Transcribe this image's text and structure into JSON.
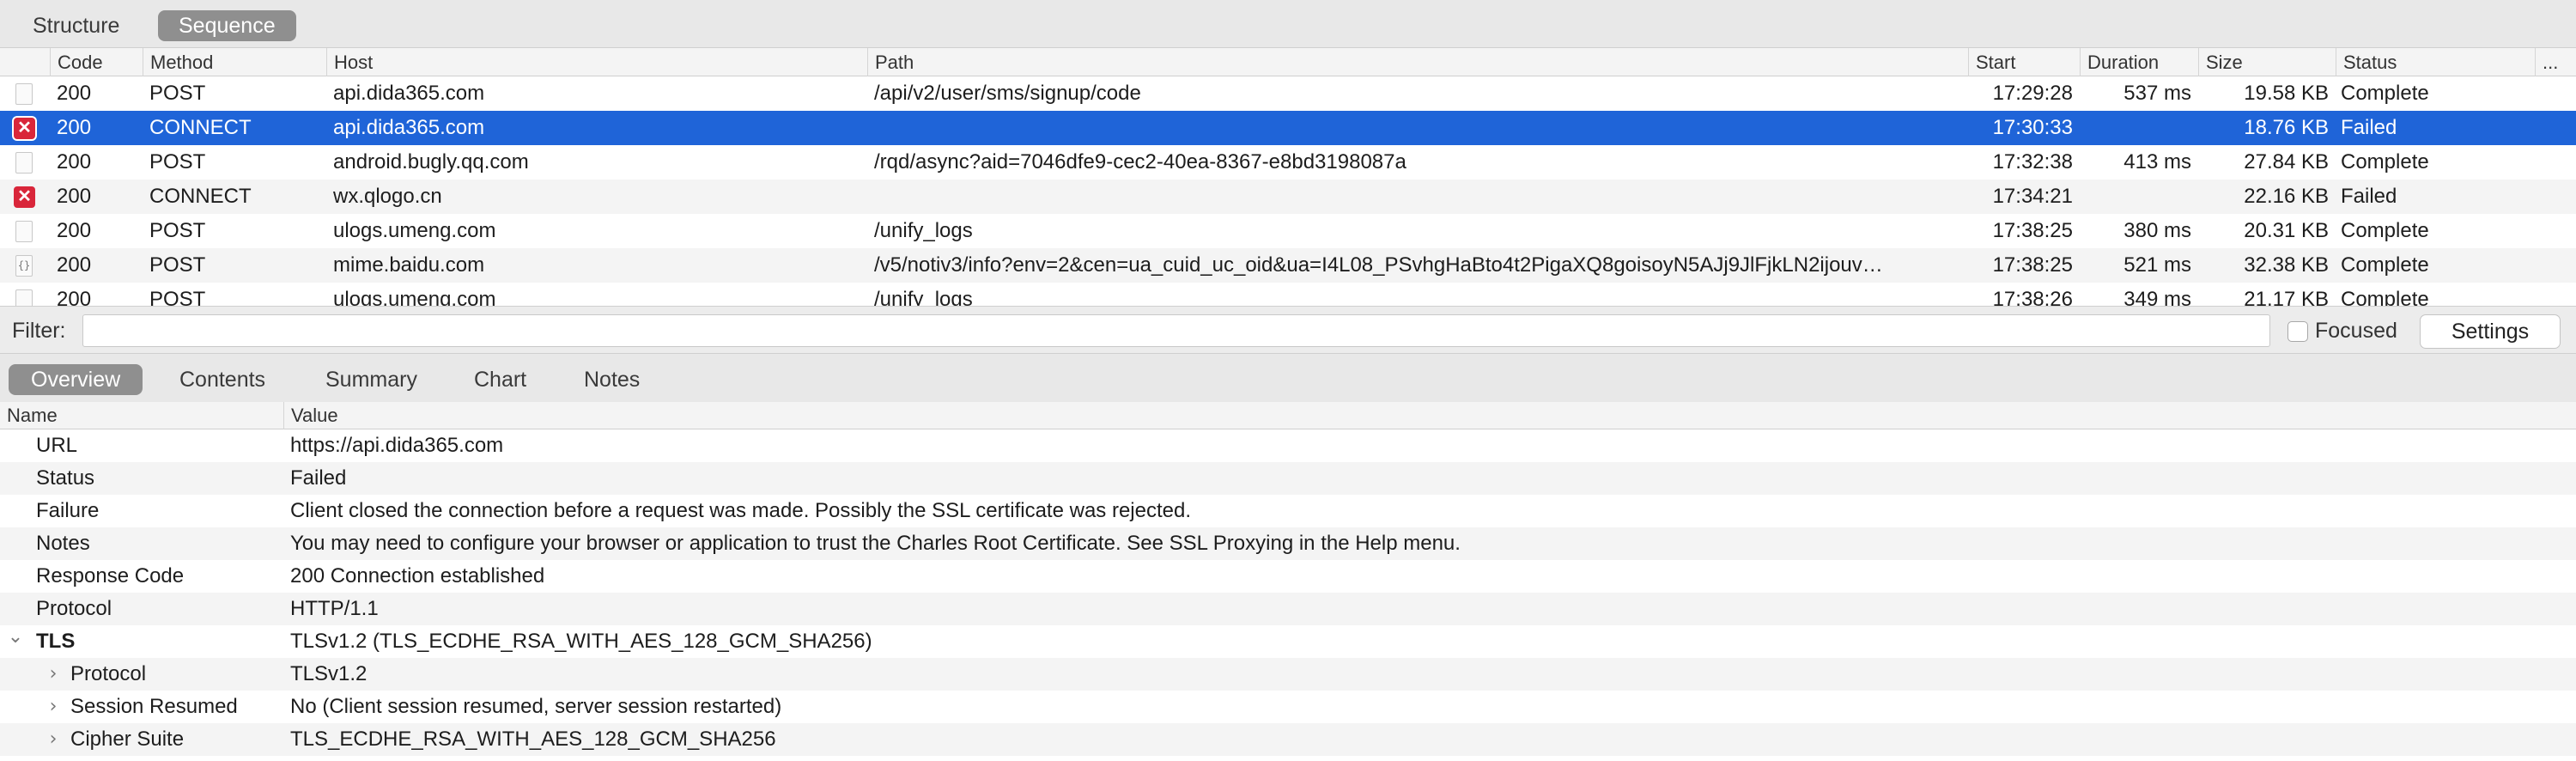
{
  "view_tabs": {
    "structure": "Structure",
    "sequence": "Sequence",
    "active": "Sequence"
  },
  "table": {
    "columns": [
      "Code",
      "Method",
      "Host",
      "Path",
      "Start",
      "Duration",
      "Size",
      "Status",
      "..."
    ],
    "rows": [
      {
        "icon": "document-icon",
        "code": "200",
        "method": "POST",
        "host": "api.dida365.com",
        "path": "/api/v2/user/sms/signup/code",
        "start": "17:29:28",
        "duration": "537 ms",
        "size": "19.58 KB",
        "status": "Complete"
      },
      {
        "icon": "error-icon",
        "code": "200",
        "method": "CONNECT",
        "host": "api.dida365.com",
        "path": "",
        "start": "17:30:33",
        "duration": "",
        "size": "18.76 KB",
        "status": "Failed",
        "selected": true
      },
      {
        "icon": "document-icon",
        "code": "200",
        "method": "POST",
        "host": "android.bugly.qq.com",
        "path": "/rqd/async?aid=7046dfe9-cec2-40ea-8367-e8bd3198087a",
        "start": "17:32:38",
        "duration": "413 ms",
        "size": "27.84 KB",
        "status": "Complete"
      },
      {
        "icon": "error-icon",
        "code": "200",
        "method": "CONNECT",
        "host": "wx.qlogo.cn",
        "path": "",
        "start": "17:34:21",
        "duration": "",
        "size": "22.16 KB",
        "status": "Failed"
      },
      {
        "icon": "document-icon",
        "code": "200",
        "method": "POST",
        "host": "ulogs.umeng.com",
        "path": "/unify_logs",
        "start": "17:38:25",
        "duration": "380 ms",
        "size": "20.31 KB",
        "status": "Complete"
      },
      {
        "icon": "json-icon",
        "code": "200",
        "method": "POST",
        "host": "mime.baidu.com",
        "path": "/v5/notiv3/info?env=2&cen=ua_cuid_uc_oid&ua=I4L08_PSvhgHaBto4t2PigaXQ8goisoyN5AJj9JlFjkLN2ijouv…",
        "start": "17:38:25",
        "duration": "521 ms",
        "size": "32.38 KB",
        "status": "Complete"
      },
      {
        "icon": "document-icon",
        "code": "200",
        "method": "POST",
        "host": "ulogs.umeng.com",
        "path": "/unify_logs",
        "start": "17:38:26",
        "duration": "349 ms",
        "size": "21.17 KB",
        "status": "Complete"
      }
    ]
  },
  "filter": {
    "label": "Filter:",
    "value": "",
    "focused_label": "Focused",
    "focused_checked": false,
    "settings_label": "Settings"
  },
  "detail_tabs": {
    "items": [
      "Overview",
      "Contents",
      "Summary",
      "Chart",
      "Notes"
    ],
    "active": "Overview"
  },
  "overview": {
    "col_name": "Name",
    "col_value": "Value",
    "rows": [
      {
        "name": "URL",
        "value": "https://api.dida365.com",
        "level": 0
      },
      {
        "name": "Status",
        "value": "Failed",
        "level": 0
      },
      {
        "name": "Failure",
        "value": "Client closed the connection before a request was made. Possibly the SSL certificate was rejected.",
        "level": 0
      },
      {
        "name": "Notes",
        "value": "You may need to configure your browser or application to trust the Charles Root Certificate. See SSL Proxying in the Help menu.",
        "level": 0
      },
      {
        "name": "Response Code",
        "value": "200 Connection established",
        "level": 0
      },
      {
        "name": "Protocol",
        "value": "HTTP/1.1",
        "level": 0
      },
      {
        "name": "TLS",
        "value": "TLSv1.2 (TLS_ECDHE_RSA_WITH_AES_128_GCM_SHA256)",
        "level": 0,
        "expanded": true,
        "bold": true
      },
      {
        "name": "Protocol",
        "value": "TLSv1.2",
        "level": 1,
        "expandable": true
      },
      {
        "name": "Session Resumed",
        "value": "No (Client session resumed, server session restarted)",
        "level": 1,
        "expandable": true
      },
      {
        "name": "Cipher Suite",
        "value": "TLS_ECDHE_RSA_WITH_AES_128_GCM_SHA256",
        "level": 1,
        "expandable": true
      }
    ]
  },
  "colors": {
    "selection": "#1f64d8",
    "error_badge": "#d9263a",
    "active_tab": "#8f8f8f"
  }
}
